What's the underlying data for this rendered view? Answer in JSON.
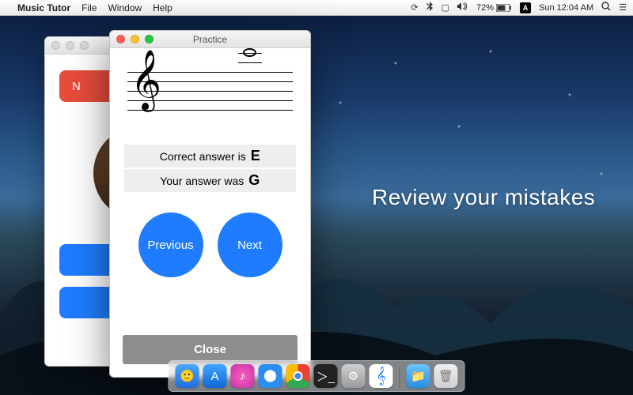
{
  "menubar": {
    "app_name": "Music Tutor",
    "menus": {
      "file": "File",
      "window": "Window",
      "help": "Help"
    },
    "status": {
      "battery_percent": "72%",
      "clock": "Sun 12:04 AM",
      "ime_label": "A"
    }
  },
  "back_window": {
    "red_button_label": "N"
  },
  "practice_window": {
    "title": "Practice",
    "correct_label": "Correct answer is",
    "correct_value": "E",
    "your_label": "Your answer was",
    "your_value": "G",
    "previous_label": "Previous",
    "next_label": "Next",
    "close_label": "Close"
  },
  "tagline": "Review your mistakes",
  "dock": {
    "items": [
      "finder",
      "appstore",
      "itunes",
      "safari",
      "chrome",
      "terminal",
      "sysprefs",
      "musictutor"
    ],
    "downloads": "downloads",
    "trash": "trash"
  }
}
